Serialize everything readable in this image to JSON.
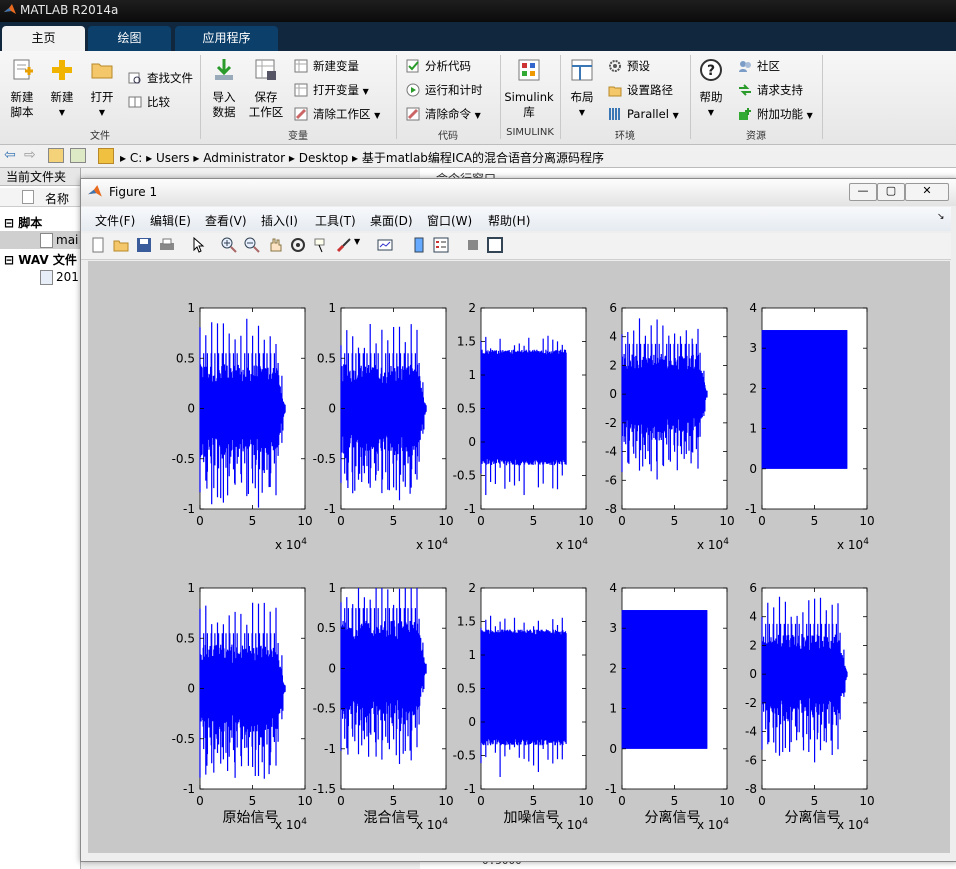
{
  "window": {
    "title": "MATLAB R2014a"
  },
  "tabs": [
    {
      "label": "主页"
    },
    {
      "label": "绘图"
    },
    {
      "label": "应用程序"
    }
  ],
  "ribbon": {
    "new_script": "新建\n脚本",
    "new": "新建",
    "open": "打开",
    "find_files": "查找文件",
    "compare": "比较",
    "import_data": "导入\n数据",
    "save_workspace": "保存\n工作区",
    "new_variable": "新建变量",
    "open_variable": "打开变量",
    "clear_workspace": "清除工作区",
    "analyze_code": "分析代码",
    "run_and_time": "运行和计时",
    "clear_commands": "清除命令",
    "simulink_library": "Simulink\n库",
    "layout": "布局",
    "preferences": "预设",
    "set_path": "设置路径",
    "parallel": "Parallel",
    "help": "帮助",
    "community": "社区",
    "request_support": "请求支持",
    "addons": "附加功能",
    "groups": {
      "file": "文件",
      "variable": "变量",
      "code": "代码",
      "simulink": "SIMULINK",
      "environment": "环境",
      "resources": "资源"
    }
  },
  "address": {
    "segments": [
      "C:",
      "Users",
      "Administrator",
      "Desktop",
      "基于matlab编程ICA的混合语音分离源码程序"
    ]
  },
  "left_pane": {
    "title": "当前文件夹",
    "column_name": "名称",
    "group1": "脚本",
    "item1": "mai",
    "group2": "WAV 文件",
    "item2": "201"
  },
  "figure": {
    "title": "Figure 1",
    "menu": [
      "文件(F)",
      "编辑(E)",
      "查看(V)",
      "插入(I)",
      "工具(T)",
      "桌面(D)",
      "窗口(W)",
      "帮助(H)"
    ]
  },
  "chart_data": [
    {
      "type": "line",
      "row": 1,
      "col": 1,
      "x_ticks": [
        "0",
        "5",
        "10"
      ],
      "y_ticks": [
        "-1",
        "-0.5",
        "0",
        "0.5",
        "1"
      ],
      "ylim": [
        -1,
        1
      ],
      "x_exponent": "x 10^4",
      "style": "speech",
      "amp": 0.55,
      "spikes": 0.9,
      "xlabel": ""
    },
    {
      "type": "line",
      "row": 1,
      "col": 2,
      "x_ticks": [
        "0",
        "5",
        "10"
      ],
      "y_ticks": [
        "-1",
        "-0.5",
        "0",
        "0.5",
        "1"
      ],
      "ylim": [
        -1,
        1
      ],
      "x_exponent": "x 10^4",
      "style": "speech",
      "amp": 0.55,
      "spikes": 0.85,
      "xlabel": ""
    },
    {
      "type": "line",
      "row": 1,
      "col": 3,
      "x_ticks": [
        "0",
        "5",
        "10"
      ],
      "y_ticks": [
        "-1",
        "-0.5",
        "0",
        "0.5",
        "1",
        "1.5",
        "2"
      ],
      "ylim": [
        -1,
        2
      ],
      "x_exponent": "x 10^4",
      "style": "noisy",
      "band": [
        -0.25,
        1.3
      ],
      "spikes": 1.6,
      "xlabel": ""
    },
    {
      "type": "line",
      "row": 1,
      "col": 4,
      "x_ticks": [
        "0",
        "5",
        "10"
      ],
      "y_ticks": [
        "-8",
        "-6",
        "-4",
        "-2",
        "0",
        "2",
        "4",
        "6"
      ],
      "ylim": [
        -8,
        6
      ],
      "x_exponent": "x 10^4",
      "style": "speech",
      "amp": 3.5,
      "spikes": 5.5,
      "xlabel": ""
    },
    {
      "type": "line",
      "row": 1,
      "col": 5,
      "x_ticks": [
        "0",
        "5",
        "10"
      ],
      "y_ticks": [
        "-1",
        "0",
        "1",
        "2",
        "3",
        "4"
      ],
      "ylim": [
        -1,
        4
      ],
      "x_exponent": "x 10^4",
      "style": "block",
      "band": [
        0,
        3.45
      ],
      "xlabel": ""
    },
    {
      "type": "line",
      "row": 2,
      "col": 1,
      "x_ticks": [
        "0",
        "5",
        "10"
      ],
      "y_ticks": [
        "-1",
        "-0.5",
        "0",
        "0.5",
        "1"
      ],
      "ylim": [
        -1,
        1
      ],
      "x_exponent": "x 10^4",
      "style": "speech",
      "amp": 0.55,
      "spikes": 0.9,
      "xlabel": "原始信号"
    },
    {
      "type": "line",
      "row": 2,
      "col": 2,
      "x_ticks": [
        "0",
        "5",
        "10"
      ],
      "y_ticks": [
        "-1.5",
        "-1",
        "-0.5",
        "0",
        "0.5",
        "1"
      ],
      "ylim": [
        -1.5,
        1
      ],
      "x_exponent": "x 10^4",
      "style": "speech",
      "amp": 0.75,
      "spikes": 1.1,
      "xlabel": "混合信号"
    },
    {
      "type": "line",
      "row": 2,
      "col": 3,
      "x_ticks": [
        "0",
        "5",
        "10"
      ],
      "y_ticks": [
        "-1",
        "-0.5",
        "0",
        "0.5",
        "1",
        "1.5",
        "2"
      ],
      "ylim": [
        -1,
        2
      ],
      "x_exponent": "x 10^4",
      "style": "noisy",
      "band": [
        -0.25,
        1.3
      ],
      "spikes": 1.6,
      "xlabel": "加噪信号"
    },
    {
      "type": "line",
      "row": 2,
      "col": 4,
      "x_ticks": [
        "0",
        "5",
        "10"
      ],
      "y_ticks": [
        "-1",
        "0",
        "1",
        "2",
        "3",
        "4"
      ],
      "ylim": [
        -1,
        4
      ],
      "x_exponent": "x 10^4",
      "style": "block",
      "band": [
        0,
        3.45
      ],
      "xlabel": "分离信号"
    },
    {
      "type": "line",
      "row": 2,
      "col": 5,
      "x_ticks": [
        "0",
        "5",
        "10"
      ],
      "y_ticks": [
        "-8",
        "-6",
        "-4",
        "-2",
        "0",
        "2",
        "4",
        "6"
      ],
      "ylim": [
        -8,
        6
      ],
      "x_exponent": "x 10^4",
      "style": "speech",
      "amp": 3.5,
      "spikes": 5.5,
      "xlabel": "分离信号"
    }
  ],
  "colors": {
    "signal": "#0000ff",
    "figure_bg": "#c8c8c8",
    "tab_active": "#f2f2f2",
    "tab_bar": "#11273e"
  },
  "background_text": {
    "cmd_header": "命令行窗口",
    "cmd_value": "0.5000"
  }
}
